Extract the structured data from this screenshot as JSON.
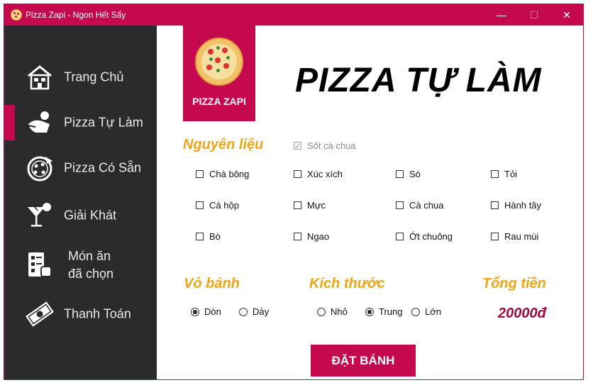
{
  "window": {
    "title": "Pizza Zapi - Ngon Hết Sẩy",
    "min_glyph": "—",
    "max_glyph": "☐",
    "close_glyph": "✕"
  },
  "sidebar": {
    "items": [
      {
        "label": "Trang Chủ",
        "icon": "house-icon"
      },
      {
        "label": "Pizza Tự Làm",
        "icon": "chef-icon",
        "active": true
      },
      {
        "label": "Pizza Có Sẵn",
        "icon": "pizza-icon"
      },
      {
        "label": "Giải Khát",
        "icon": "cocktail-icon"
      },
      {
        "label_line1": "Món ăn",
        "label_line2": "đã chọn",
        "icon": "order-list-icon"
      },
      {
        "label": "Thanh Toán",
        "icon": "money-icon"
      }
    ]
  },
  "logo": {
    "name": "PIZZA ZAPI"
  },
  "heading": "PIZZA TỰ LÀM",
  "ingredients": {
    "title": "Nguyên liệu",
    "sauce": {
      "label": "Sốt cà chua",
      "checked": true,
      "disabled": true
    },
    "items": [
      [
        "Chà bông",
        "Xúc xích",
        "Sò",
        "Tỏi"
      ],
      [
        "Cá hộp",
        "Mực",
        "Cà chua",
        "Hành tây"
      ],
      [
        "Bò",
        "Ngao",
        "Ớt chuông",
        "Rau mùi"
      ]
    ]
  },
  "crust": {
    "title": "Vỏ bánh",
    "options": [
      "Dòn",
      "Dày"
    ],
    "selected": "Dòn"
  },
  "size": {
    "title": "Kích thước",
    "options": [
      "Nhỏ",
      "Trung",
      "Lớn"
    ],
    "selected": "Trung"
  },
  "total": {
    "title": "Tổng tiền",
    "value": "20000đ"
  },
  "order_button": "ĐẶT BÁNH",
  "colors": {
    "accent": "#c4094e",
    "sidebar_bg": "#2b2a2d",
    "section_title": "#f0a516",
    "price": "#a3083f"
  }
}
